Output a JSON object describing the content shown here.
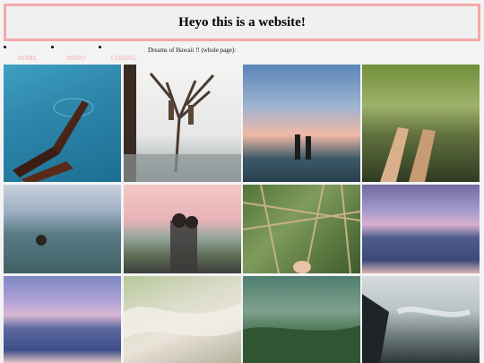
{
  "header": {
    "title": "Heyo this is a website!"
  },
  "nav": {
    "items": [
      {
        "label": "HOME"
      },
      {
        "label": "INSPO"
      },
      {
        "label": "CODING"
      }
    ],
    "caption": "Dreams of Hawaii !! (whole page):"
  },
  "colors": {
    "accent": "#f4a8aa",
    "background": "#f3f3f4"
  },
  "gallery": {
    "images": [
      {
        "subject": "legs in pool water"
      },
      {
        "subject": "two people in a bare tree by the sea"
      },
      {
        "subject": "feet up at sunset over ocean"
      },
      {
        "subject": "legs by a jungle creek"
      },
      {
        "subject": "swimmer in the ocean"
      },
      {
        "subject": "couple hugging by the road at dusk"
      },
      {
        "subject": "feet on a bamboo hammock"
      },
      {
        "subject": "ocean at dusk"
      },
      {
        "subject": "purple sunset over ocean"
      },
      {
        "subject": "crashing wave"
      },
      {
        "subject": "underwater reef"
      },
      {
        "subject": "misty coastline"
      }
    ]
  }
}
